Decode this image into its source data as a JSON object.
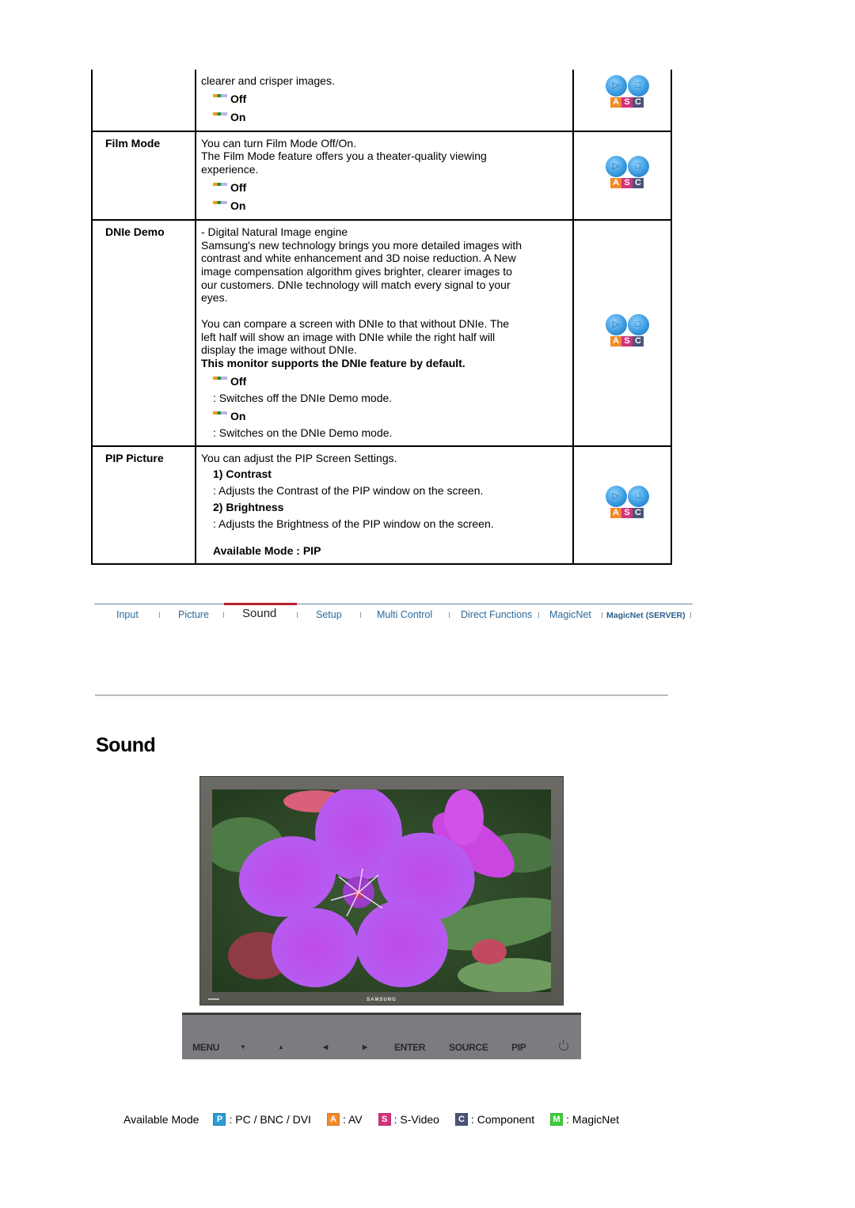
{
  "colors": {
    "bullet_orange": "#f39c1f",
    "nav_text": "#2c6a9a",
    "nav_active_bar": "#b3202b",
    "mode_a": "#f28a2a",
    "mode_s": "#d2337e",
    "mode_c": "#4a5378",
    "mode_p": "#2b9bd6",
    "mode_m": "#3ccf3a"
  },
  "feature_table": {
    "rows": [
      {
        "label": "",
        "desc_lines": [
          "clearer and crisper images."
        ],
        "options": [
          {
            "label": "Off"
          },
          {
            "label": "On"
          }
        ],
        "mode_icon": {
          "name": "ASC-mode-icon",
          "letters": [
            "A",
            "S",
            "C"
          ]
        }
      },
      {
        "label": "Film Mode",
        "desc_lines": [
          "You can turn Film Mode Off/On.",
          "The Film Mode feature offers you a theater-quality viewing experience."
        ],
        "options": [
          {
            "label": "Off"
          },
          {
            "label": "On"
          }
        ],
        "mode_icon": {
          "name": "ASC-mode-icon",
          "letters": [
            "A",
            "S",
            "C"
          ]
        }
      },
      {
        "label": "DNIe Demo",
        "desc_lines": [
          "- Digital Natural Image engine",
          "Samsung's new technology brings you more detailed images with contrast and white enhancement and 3D noise reduction. A New image compensation algorithm gives brighter, clearer images to our customers. DNIe technology will match every signal to your eyes.",
          "You can compare a screen with DNIe to that without DNIe. The left half will show an image with DNIe while the right half will display the image without DNIe."
        ],
        "note": "This monitor supports the DNIe feature by default.",
        "options": [
          {
            "label": "Off",
            "desc": ": Switches off the DNIe Demo mode."
          },
          {
            "label": "On",
            "desc": ": Switches on the DNIe Demo mode."
          }
        ],
        "mode_icon": {
          "name": "ASC-mode-icon",
          "letters": [
            "A",
            "S",
            "C"
          ]
        }
      },
      {
        "label": "PIP Picture",
        "desc_lines": [
          "You can adjust the PIP Screen Settings."
        ],
        "sub_items": [
          {
            "title": "1) Contrast",
            "desc": ": Adjusts the Contrast of the PIP window on the screen."
          },
          {
            "title": "2) Brightness",
            "desc": ": Adjusts the Brightness of the PIP window on the screen."
          }
        ],
        "available_mode": "Available Mode : PIP",
        "mode_icon": {
          "name": "ASC-mode-icon",
          "letters": [
            "A",
            "S",
            "C"
          ]
        }
      }
    ]
  },
  "nav": {
    "tabs": [
      {
        "label": "Input",
        "active": false
      },
      {
        "label": "Picture",
        "active": false
      },
      {
        "label": "Sound",
        "active": true
      },
      {
        "label": "Setup",
        "active": false
      },
      {
        "label": "Multi Control",
        "active": false
      },
      {
        "label": "Direct Functions",
        "active": false
      },
      {
        "label": "MagicNet",
        "active": false
      },
      {
        "label": "MagicNet (SERVER)",
        "active": false
      }
    ]
  },
  "section": {
    "title": "Sound"
  },
  "monitor": {
    "brand": "SAMSUNG",
    "screen_image": "purple-flower-photo"
  },
  "control_panel": {
    "buttons": [
      {
        "label": "MENU",
        "icon": ""
      },
      {
        "label": "▼",
        "icon": "down-arrow"
      },
      {
        "label": "▲",
        "icon": "up-arrow"
      },
      {
        "label": "◀",
        "icon": "left-arrow"
      },
      {
        "label": "▶",
        "icon": "right-arrow"
      },
      {
        "label": "ENTER",
        "icon": ""
      },
      {
        "label": "SOURCE",
        "icon": ""
      },
      {
        "label": "PIP",
        "icon": ""
      },
      {
        "label": "",
        "icon": "power"
      }
    ]
  },
  "legend": {
    "label": "Available Mode",
    "items": [
      {
        "badge": "P",
        "text": ": PC / BNC / DVI"
      },
      {
        "badge": "A",
        "text": ": AV"
      },
      {
        "badge": "S",
        "text": ": S-Video"
      },
      {
        "badge": "C",
        "text": ": Component"
      },
      {
        "badge": "M",
        "text": ": MagicNet"
      }
    ]
  }
}
